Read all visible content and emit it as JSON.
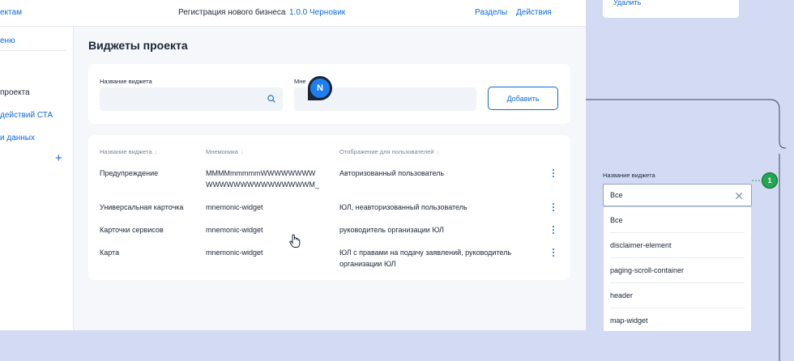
{
  "topbar": {
    "back_link": "ектам",
    "title": "Регистрация нового бизнеса",
    "version": "1.0.0 Черновик",
    "sections": "Разделы",
    "actions": "Действия"
  },
  "sidebar": {
    "items": [
      {
        "label": "еню"
      },
      {
        "label": "проекта"
      },
      {
        "label": "действий СТА"
      },
      {
        "label": "и данных"
      }
    ],
    "add_symbol": "+"
  },
  "page": {
    "title": "Виджеты проекта"
  },
  "form": {
    "name_label": "Название виджета",
    "name_value": "",
    "mnemonic_label": "Мне",
    "mnemonic_value": "",
    "add_button": "Добавить"
  },
  "table": {
    "headers": [
      "Название виджета",
      "Мнемоника",
      "Отображение для пользователей"
    ],
    "sort_symbol": "↓",
    "rows": [
      {
        "name": "Предупреждение",
        "mnemonic_line1": "MMMMmmmmmWWWWWWWW",
        "mnemonic_line2": "WWWWWWWWWWWWWWWM_",
        "display_line1": "Авторизованный пользователь",
        "display_line2": ""
      },
      {
        "name": "Универсальная карточка",
        "mnemonic_line1": "mnemonic-widget",
        "mnemonic_line2": "",
        "display_line1": "ЮЛ, неавторизованный пользователь",
        "display_line2": ""
      },
      {
        "name": "Карточки сервисов",
        "mnemonic_line1": "mnemonic-widget",
        "mnemonic_line2": "",
        "display_line1": "руководитель организации ЮЛ",
        "display_line2": ""
      },
      {
        "name": "Карта",
        "mnemonic_line1": "mnemonic-widget",
        "mnemonic_line2": "",
        "display_line1": "ЮЛ с правами на подачу заявлений, руководитель",
        "display_line2": "организации ЮЛ"
      }
    ]
  },
  "annotation_badge": "N",
  "right_panel": {
    "delete_label": "Удалить",
    "dropdown_label": "Название виджета",
    "dropdown_value": "Все",
    "options": [
      "Все",
      "disclaimer-element",
      "paging-scroll-container",
      "header",
      "map-widget"
    ],
    "step_badge": "1"
  },
  "colors": {
    "accent": "#0d6ad6",
    "canvas": "#d2dbf3",
    "step_badge": "#1fa84f"
  }
}
